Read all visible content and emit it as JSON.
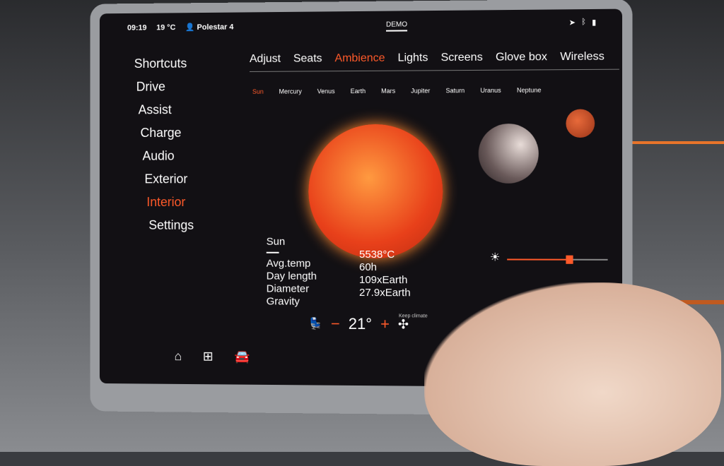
{
  "status": {
    "time": "09:19",
    "temp": "19 °C",
    "profile": "Polestar 4",
    "mode": "DEMO",
    "icons": [
      "location-icon",
      "bluetooth-icon",
      "signal-icon"
    ]
  },
  "sidebar": {
    "items": [
      {
        "label": "Shortcuts"
      },
      {
        "label": "Drive"
      },
      {
        "label": "Assist"
      },
      {
        "label": "Charge"
      },
      {
        "label": "Audio"
      },
      {
        "label": "Exterior"
      },
      {
        "label": "Interior",
        "active": true
      },
      {
        "label": "Settings"
      }
    ]
  },
  "tabs": [
    {
      "label": "Adjust"
    },
    {
      "label": "Seats"
    },
    {
      "label": "Ambience",
      "active": true
    },
    {
      "label": "Lights"
    },
    {
      "label": "Screens"
    },
    {
      "label": "Glove box"
    },
    {
      "label": "Wireless"
    }
  ],
  "planets": [
    {
      "label": "Sun",
      "active": true
    },
    {
      "label": "Mercury"
    },
    {
      "label": "Venus"
    },
    {
      "label": "Earth"
    },
    {
      "label": "Mars"
    },
    {
      "label": "Jupiter"
    },
    {
      "label": "Saturn"
    },
    {
      "label": "Uranus"
    },
    {
      "label": "Neptune"
    }
  ],
  "info": {
    "name": "Sun",
    "labels": [
      "Avg.temp",
      "Day length",
      "Diameter",
      "Gravity"
    ],
    "values": [
      "5538°C",
      "60h",
      "109xEarth",
      "27.9xEarth"
    ]
  },
  "brightness": {
    "value": 0.62
  },
  "climate": {
    "temp": "21°",
    "minus": "−",
    "plus": "+",
    "keep": "Keep climate"
  },
  "accent": "#ff5a2a"
}
